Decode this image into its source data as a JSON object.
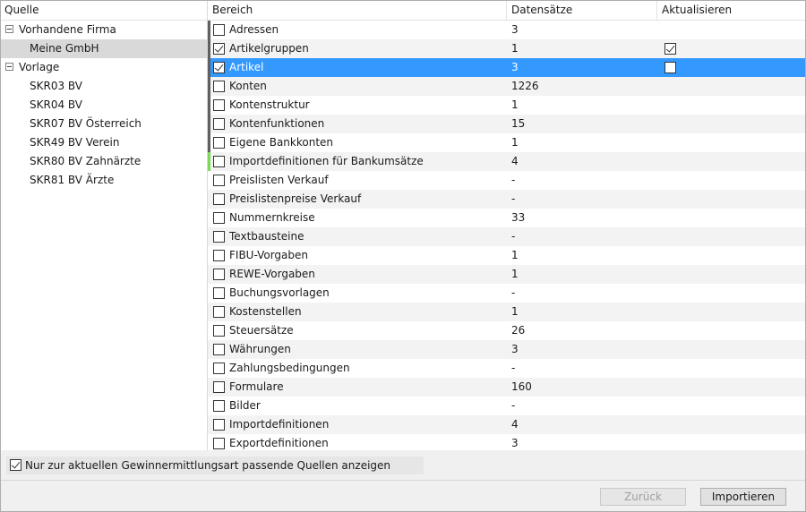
{
  "tree": {
    "header": "Quelle",
    "nodes": [
      {
        "label": "Vorhandene Firma",
        "kind": "group",
        "expanded": true
      },
      {
        "label": "Meine GmbH",
        "kind": "child",
        "selected": true
      },
      {
        "label": "Vorlage",
        "kind": "group",
        "expanded": true
      },
      {
        "label": "SKR03 BV",
        "kind": "child"
      },
      {
        "label": "SKR04 BV",
        "kind": "child"
      },
      {
        "label": "SKR07 BV Österreich",
        "kind": "child"
      },
      {
        "label": "SKR49 BV Verein",
        "kind": "child"
      },
      {
        "label": "SKR80 BV Zahnärzte",
        "kind": "child"
      },
      {
        "label": "SKR81 BV Ärzte",
        "kind": "child"
      }
    ]
  },
  "grid": {
    "columns": [
      "Bereich",
      "Datensätze",
      "Aktualisieren"
    ],
    "rows": [
      {
        "bereich": "Adressen",
        "count": "3",
        "checked": false,
        "update": null
      },
      {
        "bereich": "Artikelgruppen",
        "count": "1",
        "checked": true,
        "update": true
      },
      {
        "bereich": "Artikel",
        "count": "3",
        "checked": true,
        "update": false,
        "selected": true
      },
      {
        "bereich": "Konten",
        "count": "1226",
        "checked": false,
        "update": null
      },
      {
        "bereich": "Kontenstruktur",
        "count": "1",
        "checked": false,
        "update": null
      },
      {
        "bereich": "Kontenfunktionen",
        "count": "15",
        "checked": false,
        "update": null
      },
      {
        "bereich": "Eigene Bankkonten",
        "count": "1",
        "checked": false,
        "update": null
      },
      {
        "bereich": "Importdefinitionen für Bankumsätze",
        "count": "4",
        "checked": false,
        "update": null
      },
      {
        "bereich": "Preislisten Verkauf",
        "count": "-",
        "checked": false,
        "update": null
      },
      {
        "bereich": "Preislistenpreise Verkauf",
        "count": "-",
        "checked": false,
        "update": null
      },
      {
        "bereich": "Nummernkreise",
        "count": "33",
        "checked": false,
        "update": null
      },
      {
        "bereich": "Textbausteine",
        "count": "-",
        "checked": false,
        "update": null
      },
      {
        "bereich": "FIBU-Vorgaben",
        "count": "1",
        "checked": false,
        "update": null
      },
      {
        "bereich": "REWE-Vorgaben",
        "count": "1",
        "checked": false,
        "update": null
      },
      {
        "bereich": "Buchungsvorlagen",
        "count": "-",
        "checked": false,
        "update": null
      },
      {
        "bereich": "Kostenstellen",
        "count": "1",
        "checked": false,
        "update": null
      },
      {
        "bereich": "Steuersätze",
        "count": "26",
        "checked": false,
        "update": null
      },
      {
        "bereich": "Währungen",
        "count": "3",
        "checked": false,
        "update": null
      },
      {
        "bereich": "Zahlungsbedingungen",
        "count": "-",
        "checked": false,
        "update": null
      },
      {
        "bereich": "Formulare",
        "count": "160",
        "checked": false,
        "update": null
      },
      {
        "bereich": "Bilder",
        "count": "-",
        "checked": false,
        "update": null
      },
      {
        "bereich": "Importdefinitionen",
        "count": "4",
        "checked": false,
        "update": null
      },
      {
        "bereich": "Exportdefinitionen",
        "count": "3",
        "checked": false,
        "update": null
      }
    ]
  },
  "filter": {
    "label": "Nur zur aktuellen Gewinnermittlungsart passende Quellen anzeigen",
    "checked": true
  },
  "buttons": {
    "back": "Zurück",
    "import": "Importieren"
  },
  "colors": {
    "selection": "#3399ff",
    "tree_selection": "#d9d9d9",
    "mark_dark": "#606060",
    "mark_green": "#7ed957"
  }
}
